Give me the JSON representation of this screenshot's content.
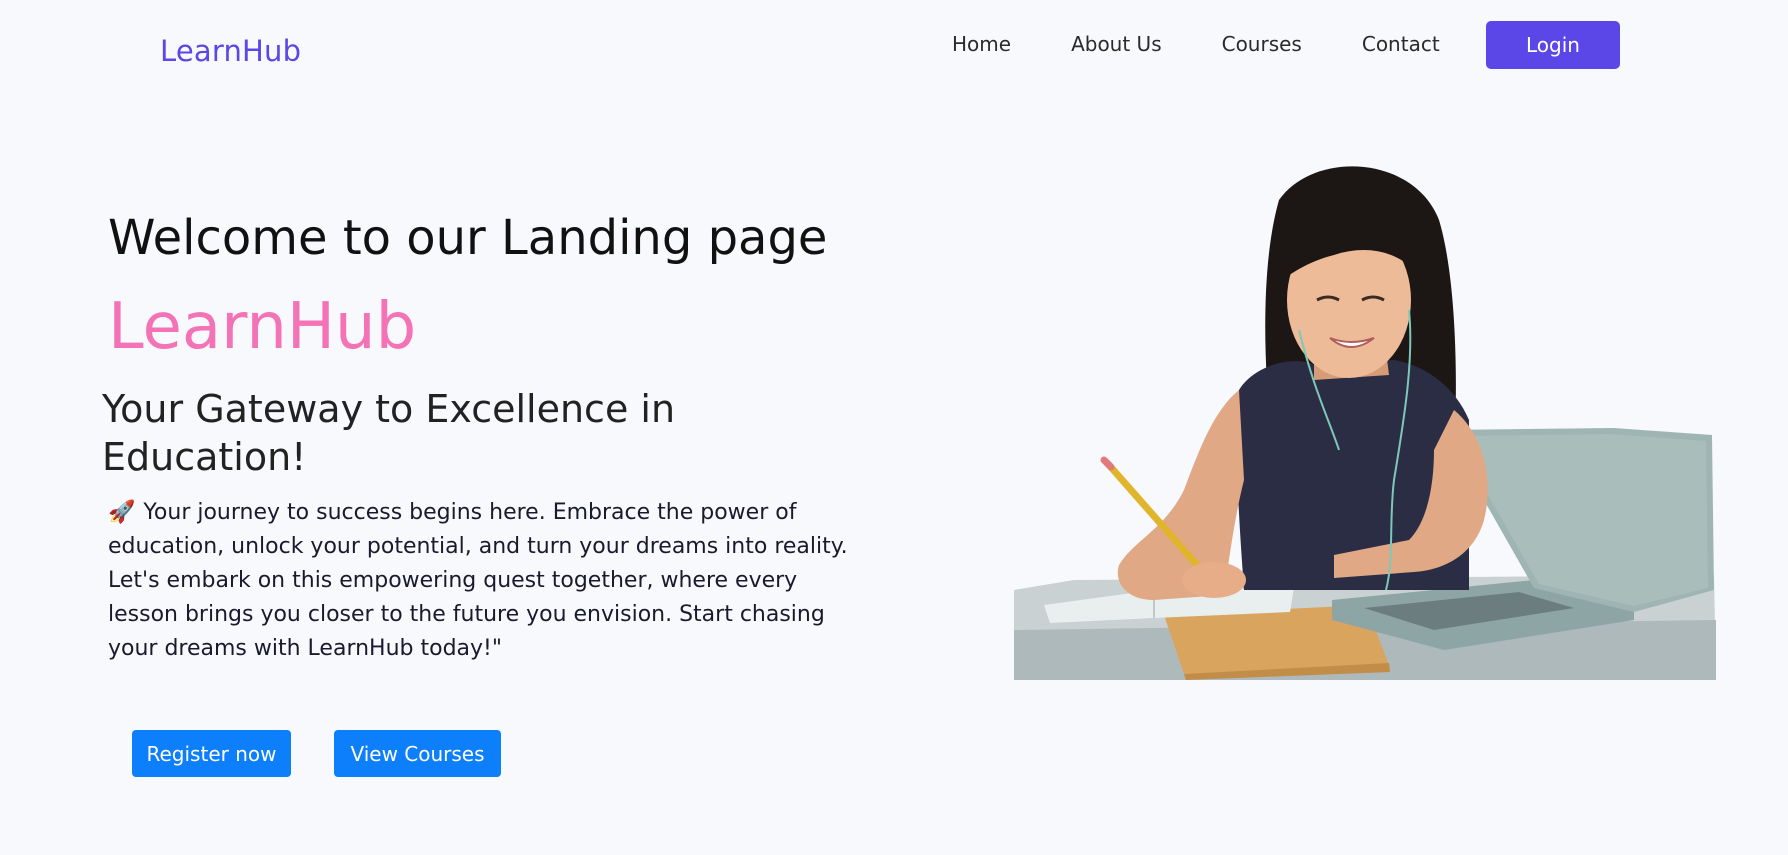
{
  "navbar": {
    "brand": "LearnHub",
    "links": [
      "Home",
      "About Us",
      "Courses",
      "Contact"
    ],
    "login_label": "Login"
  },
  "hero": {
    "welcome": "Welcome to our Landing page",
    "brand": "LearnHub",
    "tagline": "Your Gateway to Excellence in Education!",
    "rocket_icon": "🚀",
    "intro": "Your journey to success begins here. Embrace the power of education, unlock your potential, and turn your dreams into reality. Let's embark on this empowering quest together, where every lesson brings you closer to the future you envision. Start chasing your dreams with LearnHub today!\"",
    "register_label": "Register now",
    "courses_label": "View Courses"
  },
  "colors": {
    "brand": "#5a47e6",
    "login_button": "#5b47e8",
    "hero_brand": "#f472b6",
    "primary_button": "#0d7ffb",
    "background": "#f8f9fc"
  },
  "image": {
    "icon": "student-with-laptop-illustration"
  }
}
